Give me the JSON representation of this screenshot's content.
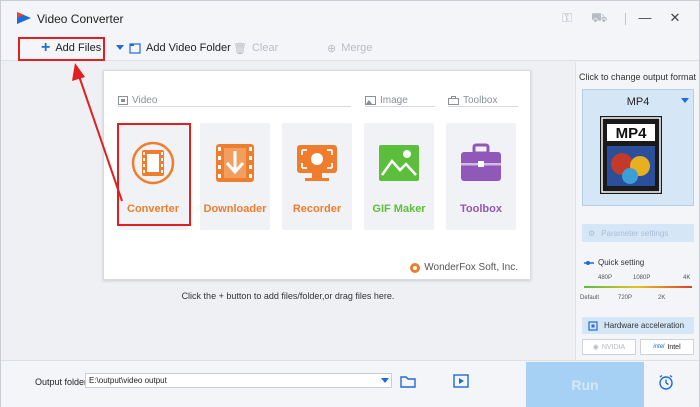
{
  "app": {
    "title": "Video Converter"
  },
  "toolbar": {
    "add_files": "Add Files",
    "add_video_folder": "Add Video Folder",
    "clear": "Clear",
    "merge": "Merge"
  },
  "sections": {
    "video": "Video",
    "image": "Image",
    "toolbox": "Toolbox"
  },
  "tiles": [
    {
      "label": "Converter",
      "color": "#ee7e2d",
      "icon": "film-reel-icon"
    },
    {
      "label": "Downloader",
      "color": "#ee7e2d",
      "icon": "download-icon"
    },
    {
      "label": "Recorder",
      "color": "#ee7e2d",
      "icon": "screen-record-icon"
    },
    {
      "label": "GIF Maker",
      "color": "#5bbf3b",
      "icon": "picture-icon"
    },
    {
      "label": "Toolbox",
      "color": "#9058b8",
      "icon": "toolbox-icon"
    }
  ],
  "copyright": "WonderFox Soft, Inc.",
  "hint": "Click the + button to add files/folder,or drag files here.",
  "right_panel": {
    "click_change": "Click to change output format",
    "format": "MP4",
    "format_badge": "MP4",
    "parameter_settings": "Parameter settings",
    "quick_setting": "Quick setting",
    "res_top": [
      "480P",
      "1080P",
      "4K"
    ],
    "res_bottom": [
      "Default",
      "720P",
      "2K"
    ],
    "hardware_acceleration": "Hardware acceleration",
    "nvidia": "NVIDIA",
    "intel": "Intel",
    "intel_badge": "intel"
  },
  "bottom": {
    "output_folder_label": "Output folder:",
    "output_folder_value": "E:\\output\\video output",
    "run": "Run"
  }
}
